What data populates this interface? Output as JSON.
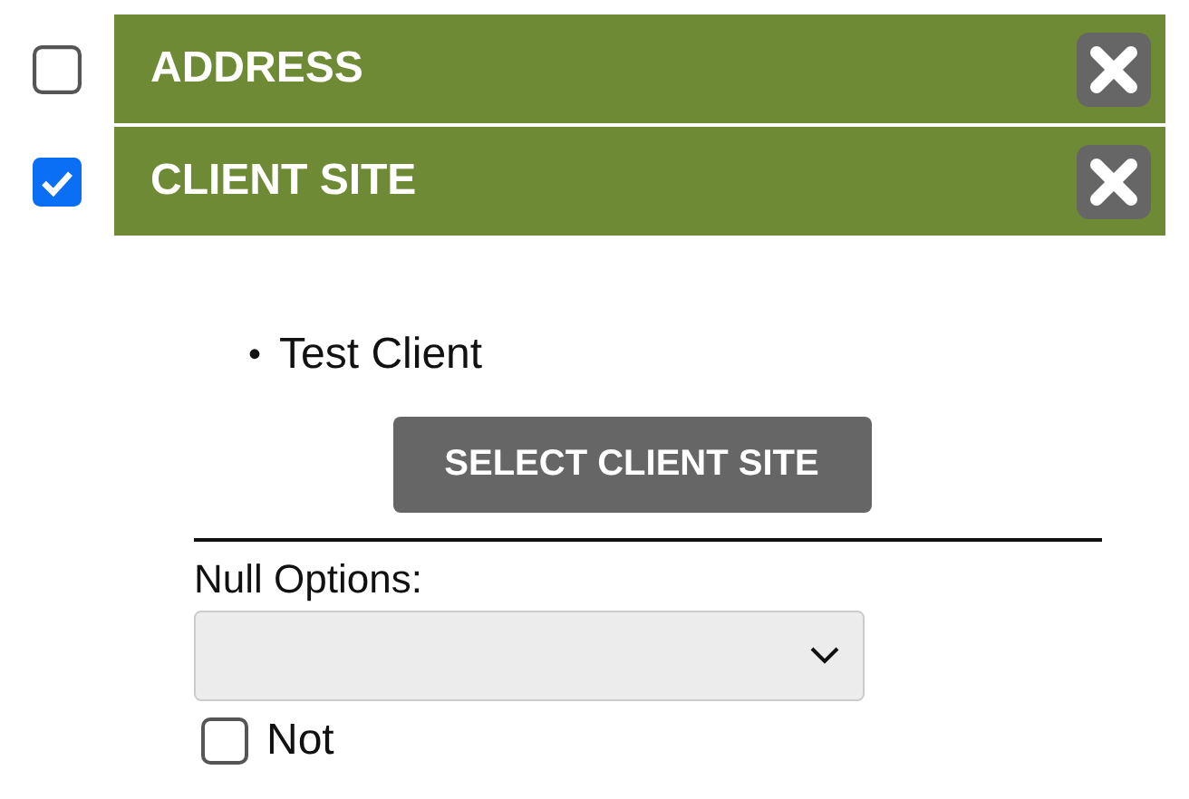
{
  "filters": [
    {
      "label": "ADDRESS",
      "checked": false
    },
    {
      "label": "CLIENT SITE",
      "checked": true
    }
  ],
  "client_site_panel": {
    "items": [
      {
        "bullet": "•",
        "text": "Test Client"
      }
    ],
    "button": "SELECT CLIENT SITE",
    "null_options_label": "Null Options:",
    "not_checkbox": {
      "label": "Not",
      "checked": false
    }
  }
}
